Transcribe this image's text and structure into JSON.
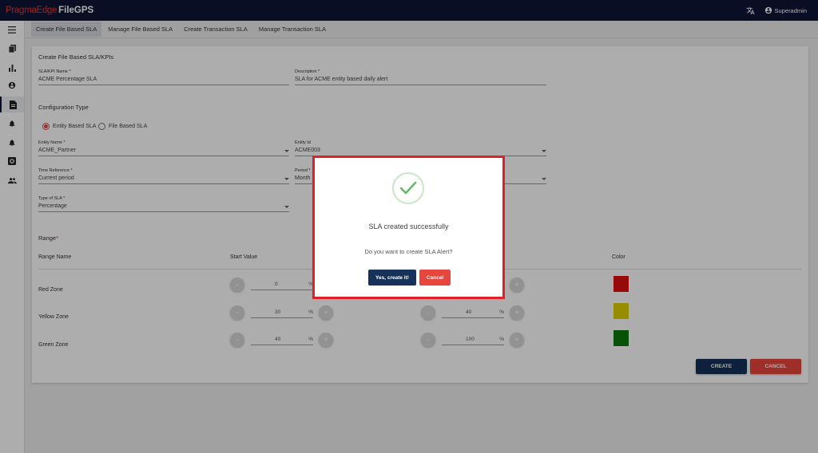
{
  "app": {
    "brand": "PragmaEdge",
    "product": "FileGPS",
    "user": "Superadmin"
  },
  "tabs": [
    {
      "label": "Create File Based SLA",
      "active": true
    },
    {
      "label": "Manage File Based SLA"
    },
    {
      "label": "Create Transaction SLA"
    },
    {
      "label": "Manage Transaction SLA"
    }
  ],
  "sidebar": [
    "menu-icon",
    "files-icon",
    "bar-chart-icon",
    "account-icon",
    "document-icon",
    "alert-bell-icon",
    "alarm-bell-icon",
    "settings-box-icon",
    "people-icon"
  ],
  "form": {
    "section_title": "Create File Based SLA/KPIs",
    "sla_name": {
      "label": "SLA/KPI Name *",
      "value": "ACME Percentage SLA"
    },
    "description": {
      "label": "Description *",
      "value": "SLA for ACME entity based daily alert"
    },
    "config_title": "Configuration Type",
    "config_options": {
      "entity": "Entity Based SLA",
      "file": "File Based SLA",
      "selected": "entity"
    },
    "entity_name": {
      "label": "Entity Name *",
      "value": "ACME_Partner"
    },
    "entity_id": {
      "label": "Entity Id",
      "value": "ACME003"
    },
    "time_reference": {
      "label": "Time Reference *",
      "value": "Current period"
    },
    "period": {
      "label": "Period *",
      "value": "Month"
    },
    "sla_type": {
      "label": "Type of SLA *",
      "value": "Percentage"
    },
    "range_title": "Range",
    "range_required": "*",
    "range_headers": {
      "name": "Range Name",
      "start": "Start Value",
      "color": "Color"
    },
    "zones": [
      {
        "name": "Red Zone",
        "start": "0",
        "color": "#e01010"
      },
      {
        "name": "Yellow Zone",
        "start": "30",
        "end": "40",
        "color": "#dfd000"
      },
      {
        "name": "Green Zone",
        "start": "40",
        "end": "100",
        "color": "#0b7a0b"
      }
    ],
    "percent_sign": "%",
    "minus": "-",
    "plus": "+",
    "create_label": "CREATE",
    "cancel_label": "CANCEL"
  },
  "modal": {
    "title": "SLA created successfully",
    "text": "Do you want to create SLA Alert?",
    "confirm_label": "Yes, create it!",
    "cancel_label": "Cancel"
  },
  "colors": {
    "navy": "#0e1537",
    "confirm": "#163259",
    "danger": "#e8453c",
    "highlight": "#e01f2a",
    "success": "#5cb85c"
  }
}
